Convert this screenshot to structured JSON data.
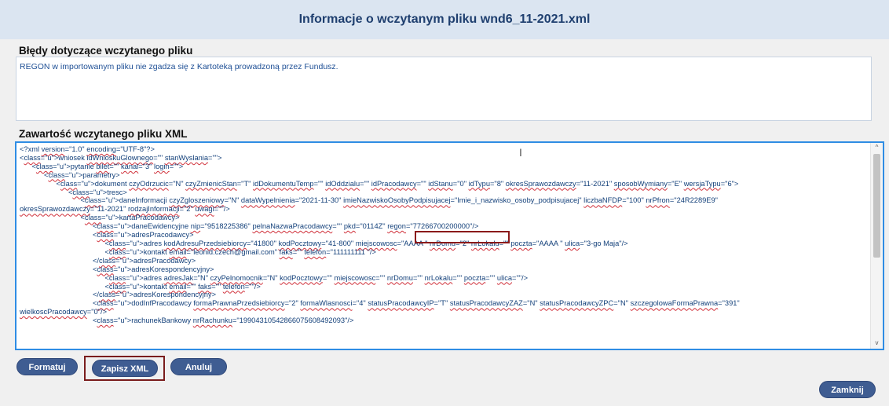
{
  "dialog": {
    "title": "Informacje o wczytanym pliku wnd6_11-2021.xml"
  },
  "errors": {
    "heading": "Błędy dotyczące wczytanego pliku",
    "message": "REGON w importowanym pliku nie zgadza się z Kartoteką prowadzoną przez Fundusz."
  },
  "xml": {
    "heading": "Zawartość wczytanego pliku XML",
    "lines": [
      "<?xml version=\"1.0\" encoding=\"UTF-8\"?>",
      "<wniosek idWnioskuGlownego=\"\" stanWyslania=\"\">",
      "      <pytanie bilet=\"\" kanal=\"3\" login=\"\">",
      "            <parametry>",
      "                  <dokument czyOdrzucic=\"N\" czyZmienicStan=\"T\" idDokumentuTemp=\"\" idOddzialu=\"\" idPracodawcy=\"\" idStanu=\"0\" idTypu=\"8\" okresSprawozdawczy=\"11-2021\" sposobWymiany=\"E\" wersjaTypu=\"6\">",
      "                        <tresc>",
      "                              <daneInformacji czyZgloszeniowy=\"N\" dataWypelnienia=\"2021-11-30\" imieNazwiskoOsobyPodpisujacej=\"Imie_i_nazwisko_osoby_podpisujacej\" liczbaNFDP=\"100\" nrPfron=\"24R2289E9\"",
      "okresSprawozdawczy=\"11-2021\" rodzajInformacji=\"2\" uwagi=\"\"/>",
      "                              <kartaPracodawcy>",
      "                                    <daneEwidencyjne nip=\"9518225386\" pelnaNazwaPracodawcy=\"\" pkd=\"0114Z\" regon=\"77266700200000\"/>",
      "                                    <adresPracodawcy>",
      "                                          <adres kodAdresuPrzedsiebiorcy=\"41800\" kodPocztowy=\"41-800\" miejscowosc=\"AAAA \" nrDomu=\"2\" nrLokalu=\"\" poczta=\"AAAA \" ulica=\"3-go Maja\"/>",
      "                                          <kontakt email=\"leonid.czech@gmail.com\" faks=\"\" telefon=\"111111111 \"/>",
      "                                    </adresPracodawcy>",
      "                                    <adresKorespondencyjny>",
      "                                          <adres adresJak=\"N\" czyPelnomocnik=\"N\" kodPocztowy=\"\" miejscowosc=\"\" nrDomu=\"\" nrLokalu=\"\" poczta=\"\" ulica=\"\"/>",
      "                                          <kontakt email=\"\" faks=\"\" telefon=\"\"/>",
      "                                    </adresKorespondencyjny>",
      "                                    <dodInfPracodawcy formaPrawnaPrzedsiebiorcy=\"2\" formaWlasnosci=\"4\" statusPracodawcyIP=\"T\" statusPracodawcyZAZ=\"N\" statusPracodawcyZPC=\"N\" szczegolowaFormaPrawna=\"391\"",
      "wielkoscPracodawcy=\"0\"/>",
      "                                    <rachunekBankowy nrRachunku=\"19904310542866075608492093\"/>"
    ]
  },
  "buttons": {
    "format": "Formatuj",
    "save_xml": "Zapisz XML",
    "cancel": "Anuluj",
    "close": "Zamknij"
  },
  "scrollbar": {
    "up_glyph": "^",
    "down_glyph": "v"
  }
}
